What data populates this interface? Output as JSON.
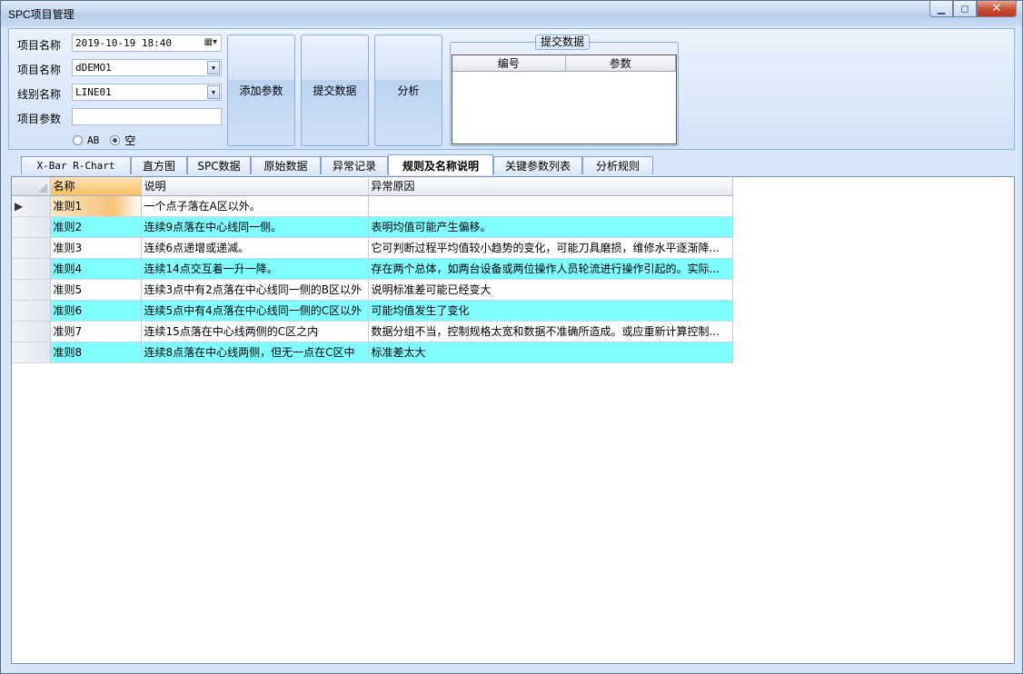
{
  "window": {
    "title": "SPC项目管理",
    "minimize": "▁",
    "restore": "◻",
    "close": "✕"
  },
  "form": {
    "fields": [
      {
        "label": "项目名称",
        "value": "2019-10-19 18:40",
        "control": "datetime"
      },
      {
        "label": "项目名称",
        "value": "dDEMO1",
        "control": "dropdown"
      },
      {
        "label": "线别名称",
        "value": "LINE01",
        "control": "dropdown"
      },
      {
        "label": "项目参数",
        "value": "",
        "control": "text"
      }
    ],
    "radios": [
      {
        "label": "AB",
        "checked": false
      },
      {
        "label": "空",
        "checked": true
      }
    ]
  },
  "buttons": {
    "add_param": "添加参数",
    "submit_data": "提交数据",
    "analyze": "分析"
  },
  "submit_group": {
    "title": "提交数据",
    "columns": [
      "编号",
      "参数"
    ]
  },
  "tabs": [
    {
      "label": "X-Bar R-Chart",
      "active": false
    },
    {
      "label": "直方图",
      "active": false
    },
    {
      "label": "SPC数据",
      "active": false
    },
    {
      "label": "原始数据",
      "active": false
    },
    {
      "label": "异常记录",
      "active": false
    },
    {
      "label": "规则及名称说明",
      "active": true
    },
    {
      "label": "关键参数列表",
      "active": false
    },
    {
      "label": "分析规则",
      "active": false
    }
  ],
  "grid": {
    "columns": [
      "名称",
      "说明",
      "异常原因"
    ],
    "current_row_marker": "▶",
    "rows": [
      {
        "name": "准则1",
        "desc": "一个点子落在A区以外。",
        "reason": ""
      },
      {
        "name": "准则2",
        "desc": "连续9点落在中心线同一侧。",
        "reason": "表明均值可能产生偏移。"
      },
      {
        "name": "准则3",
        "desc": "连续6点递增或递减。",
        "reason": "它可判断过程平均值较小趋势的变化，可能刀具磨损，维修水平逐渐降..."
      },
      {
        "name": "准则4",
        "desc": "连续14点交互着一升一降。",
        "reason": "存在两个总体，如两台设备或两位操作人员轮流进行操作引起的。实际..."
      },
      {
        "name": "准则5",
        "desc": "连续3点中有2点落在中心线同一侧的B区以外",
        "reason": "说明标准差可能已经变大"
      },
      {
        "name": "准则6",
        "desc": "连续5点中有4点落在中心线同一侧的C区以外",
        "reason": "可能均值发生了变化"
      },
      {
        "name": "准则7",
        "desc": "连续15点落在中心线两侧的C区之内",
        "reason": "数据分组不当，控制规格太宽和数据不准确所造成。或应重新计算控制..."
      },
      {
        "name": "准则8",
        "desc": "连续8点落在中心线两侧，但无一点在C区中",
        "reason": "标准差太大"
      }
    ]
  },
  "colors": {
    "alt_row": "#80ffff",
    "sorted_header": "#f7bf64",
    "panel": "#d6e6f8"
  }
}
